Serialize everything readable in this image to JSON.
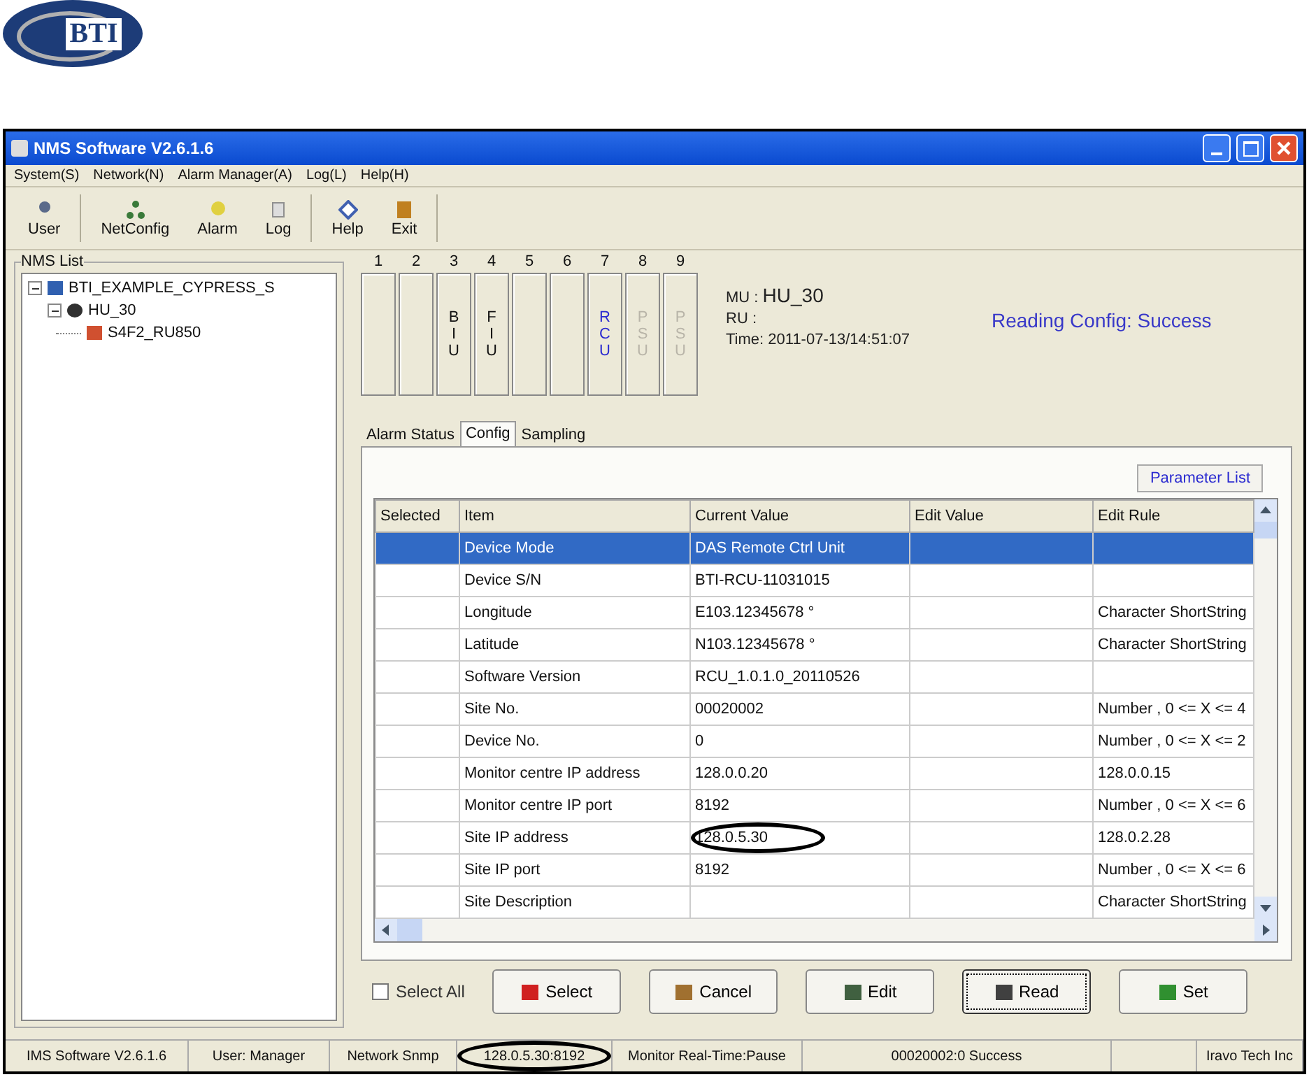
{
  "logo": {
    "text": "BTI"
  },
  "window": {
    "title": "NMS Software V2.6.1.6"
  },
  "menu": [
    "System(S)",
    "Network(N)",
    "Alarm Manager(A)",
    "Log(L)",
    "Help(H)"
  ],
  "toolbar": [
    {
      "label": "User"
    },
    {
      "label": "NetConfig"
    },
    {
      "label": "Alarm"
    },
    {
      "label": "Log"
    },
    {
      "label": "Help"
    },
    {
      "label": "Exit"
    }
  ],
  "nms_list": {
    "title": "NMS List",
    "tree": [
      {
        "label": "BTI_EXAMPLE_CYPRESS_S",
        "expanded": true,
        "children": [
          {
            "label": "HU_30",
            "expanded": true,
            "children": [
              {
                "label": "S4F2_RU850"
              }
            ]
          }
        ]
      }
    ]
  },
  "slots": [
    {
      "number": "1",
      "kind": "empty"
    },
    {
      "number": "2",
      "kind": "empty"
    },
    {
      "number": "3",
      "letters": [
        "B",
        "I",
        "U"
      ],
      "kind": "normal"
    },
    {
      "number": "4",
      "letters": [
        "F",
        "I",
        "U"
      ],
      "kind": "normal"
    },
    {
      "number": "5",
      "kind": "empty"
    },
    {
      "number": "6",
      "kind": "empty"
    },
    {
      "number": "7",
      "letters": [
        "R",
        "C",
        "U"
      ],
      "kind": "active"
    },
    {
      "number": "8",
      "letters": [
        "P",
        "S",
        "U"
      ],
      "kind": "disabled"
    },
    {
      "number": "9",
      "letters": [
        "P",
        "S",
        "U"
      ],
      "kind": "disabled"
    }
  ],
  "info": {
    "mu_label": "MU :",
    "mu_value": "HU_30",
    "ru_label": "RU :",
    "time_label": "Time:",
    "time_value": "2011-07-13/14:51:07",
    "status": "Reading Config: Success"
  },
  "tabs": [
    {
      "label": "Alarm Status",
      "selected": false
    },
    {
      "label": "Config",
      "selected": true
    },
    {
      "label": "Sampling",
      "selected": false
    }
  ],
  "parameter_list_button": "Parameter List",
  "table": {
    "columns": [
      "Selected",
      "Item",
      "Current Value",
      "Edit Value",
      "Edit Rule"
    ],
    "rows": [
      {
        "selected": true,
        "item": "Device Mode",
        "current": "DAS Remote Ctrl Unit"
      },
      {
        "selected": false,
        "item": "Device S/N",
        "current": "BTI-RCU-11031015"
      },
      {
        "selected": false,
        "item": "Longitude",
        "current": "E103.12345678 °",
        "rule": "Character ShortString"
      },
      {
        "selected": false,
        "item": "Latitude",
        "current": "N103.12345678 °",
        "rule": "Character ShortString"
      },
      {
        "selected": false,
        "item": "Software Version",
        "current": "RCU_1.0.1.0_20110526"
      },
      {
        "selected": false,
        "item": "Site No.",
        "current": "00020002",
        "rule": "Number , 0 <= X <= 4"
      },
      {
        "selected": false,
        "item": "Device No.",
        "current": "0",
        "rule": "Number , 0 <= X <= 2"
      },
      {
        "selected": false,
        "item": "Monitor centre IP address",
        "current": "128.0.0.20",
        "rule": "128.0.0.15"
      },
      {
        "selected": false,
        "item": "Monitor centre IP port",
        "current": "8192",
        "rule": "Number , 0 <= X <= 6"
      },
      {
        "selected": false,
        "item": "Site IP address",
        "current": "128.0.5.30",
        "rule": "128.0.2.28",
        "circled": true
      },
      {
        "selected": false,
        "item": "Site IP port",
        "current": "8192",
        "rule": "Number , 0 <= X <= 6"
      },
      {
        "selected": false,
        "item": "Site Description",
        "rule": "Character ShortString"
      }
    ]
  },
  "select_all": {
    "label": "Select All",
    "checked": false
  },
  "buttons": [
    {
      "label": "Select",
      "focused": false
    },
    {
      "label": "Cancel",
      "focused": false
    },
    {
      "label": "Edit",
      "focused": false
    },
    {
      "label": "Read",
      "focused": true
    },
    {
      "label": "Set",
      "focused": false
    }
  ],
  "status_bar": [
    {
      "text": "IMS Software V2.6.1.6"
    },
    {
      "text": "User: Manager"
    },
    {
      "text": "Network Snmp"
    },
    {
      "text": "128.0.5.30:8192",
      "circled": true
    },
    {
      "text": "Monitor Real-Time:Pause"
    },
    {
      "text": "00020002:0 Success"
    },
    {
      "text": "Iravo Tech Inc"
    }
  ]
}
